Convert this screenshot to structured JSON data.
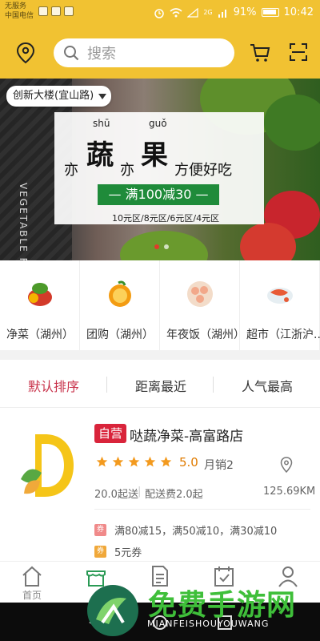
{
  "status_bar": {
    "carrier_line1": "无服务",
    "carrier_line2": "中国电信",
    "network": "2G",
    "battery": "91%",
    "time": "10:42"
  },
  "header": {
    "search_placeholder": "搜索",
    "location_label": "创新大楼(宜山路)",
    "accent_color": "#f1c232"
  },
  "banner": {
    "vertical_text": "VEGETABLE FRUIT",
    "headline_parts": [
      "亦",
      "蔬",
      "亦",
      "果",
      "方便好吃"
    ],
    "pinyin_1": "shū",
    "pinyin_2": "guǒ",
    "promo": "— 满100减30 —",
    "zones": "10元区/8元区/6元区/4元区",
    "slide_count": 2,
    "active_slide": 1
  },
  "categories": [
    {
      "label": "净菜（湖州）",
      "icon": "vegetable-icon"
    },
    {
      "label": "团购（湖州）",
      "icon": "orange-icon"
    },
    {
      "label": "年夜饭（湖州）",
      "icon": "meatball-icon"
    },
    {
      "label": "超市（江浙沪...",
      "icon": "seafood-icon"
    }
  ],
  "sort_tabs": [
    {
      "label": "默认排序",
      "active": true
    },
    {
      "label": "距离最近",
      "active": false
    },
    {
      "label": "人气最高",
      "active": false
    }
  ],
  "store": {
    "badge": "自营",
    "name": "哒蔬净菜-高富路店",
    "stars": 5,
    "rating": "5.0",
    "sales": "月销2",
    "min_order": "20.0起送",
    "delivery_fee": "配送费2.0起",
    "distance": "125.69KM",
    "promos": [
      {
        "icon_text": "券",
        "text": "满80减15，满50减10，满30减10",
        "color": "#f08a8a"
      },
      {
        "icon_text": "券",
        "text": "5元券",
        "color": "#f0a83a"
      }
    ]
  },
  "bottom_nav": [
    {
      "label": "首页",
      "icon": "home-icon",
      "active": false
    },
    {
      "label": "",
      "icon": "store-icon",
      "active": true
    },
    {
      "label": "",
      "icon": "orders-icon",
      "active": false
    },
    {
      "label": "",
      "icon": "calendar-check-icon",
      "active": false
    },
    {
      "label": "",
      "icon": "profile-icon",
      "active": false
    }
  ],
  "watermark": {
    "title": "免费手游网",
    "subtitle": "MIANFEISHOUYOUWANG"
  }
}
